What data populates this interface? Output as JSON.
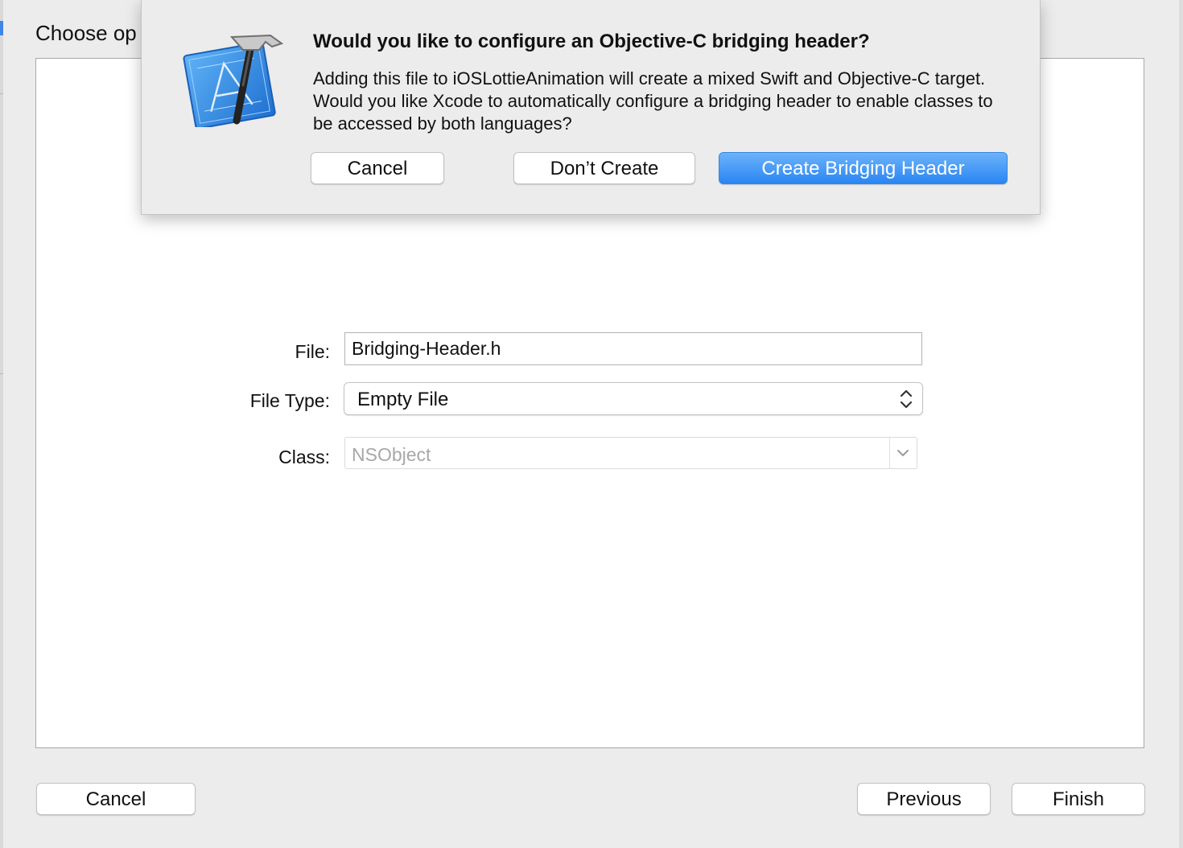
{
  "sheet": {
    "title": "Choose op",
    "form": {
      "file_label": "File:",
      "file_value": "Bridging-Header.h",
      "file_type_label": "File Type:",
      "file_type_value": "Empty File",
      "class_label": "Class:",
      "class_value": "NSObject"
    },
    "buttons": {
      "cancel": "Cancel",
      "previous": "Previous",
      "finish": "Finish"
    }
  },
  "alert": {
    "icon": "xcode-app-icon",
    "title": "Would you like to configure an Objective-C bridging header?",
    "message": "Adding this file to iOSLottieAnimation will create a mixed Swift and Objective-C target. Would you like Xcode to automatically configure a bridging header to enable classes to be accessed by both languages?",
    "buttons": {
      "cancel": "Cancel",
      "dont_create": "Don’t Create",
      "create": "Create Bridging Header"
    }
  },
  "colors": {
    "accent": "#2a85f3",
    "window_bg": "#ececec",
    "panel_bg": "#ffffff"
  }
}
